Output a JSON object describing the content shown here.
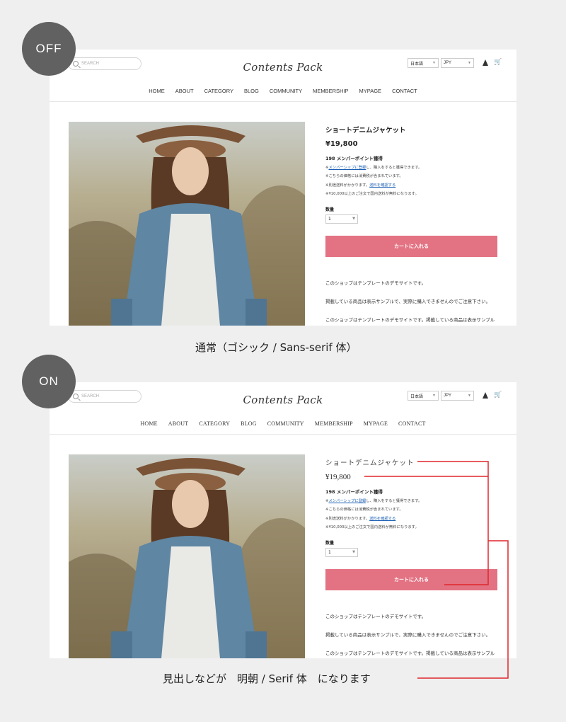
{
  "badges": {
    "off": "OFF",
    "on": "ON"
  },
  "store": {
    "search_placeholder": "SEARCH",
    "logo": "Contents Pack",
    "language": "日本語",
    "currency": "JPY",
    "nav": [
      "HOME",
      "ABOUT",
      "CATEGORY",
      "BLOG",
      "COMMUNITY",
      "MEMBERSHIP",
      "MYPAGE",
      "CONTACT"
    ],
    "product": {
      "title": "ショートデニムジャケット",
      "price": "¥19,800",
      "points": "198 メンバーポイント獲得",
      "note1_prefix": "※",
      "note1_link": "メンバーシップに登録",
      "note1_suffix": "し、購入をすると獲得できます。",
      "note2": "※こちらの価格には消費税が含まれています。",
      "note3_prefix": "※別途送料がかかります。",
      "note3_link": "送料を確認する",
      "note4": "※¥10,000以上のご注文で国内送料が無料になります。",
      "qty_label": "数量",
      "qty_value": "1",
      "cart_button": "カートに入れる",
      "desc1": "このショップはテンプレートのデモサイトです。",
      "desc2": "掲載している商品は表示サンプルで、実際に購入できませんのでご注意下さい。",
      "desc3": "このショップはテンプレートのデモサイトです。掲載している商品は表示サンプル"
    }
  },
  "captions": {
    "off": "通常（ゴシック / Sans-serif 体）",
    "on": "見出しなどが　明朝 / Serif 体　になります"
  },
  "colors": {
    "accent": "#e37283",
    "annotation": "#e0262c",
    "badge": "#616161"
  }
}
